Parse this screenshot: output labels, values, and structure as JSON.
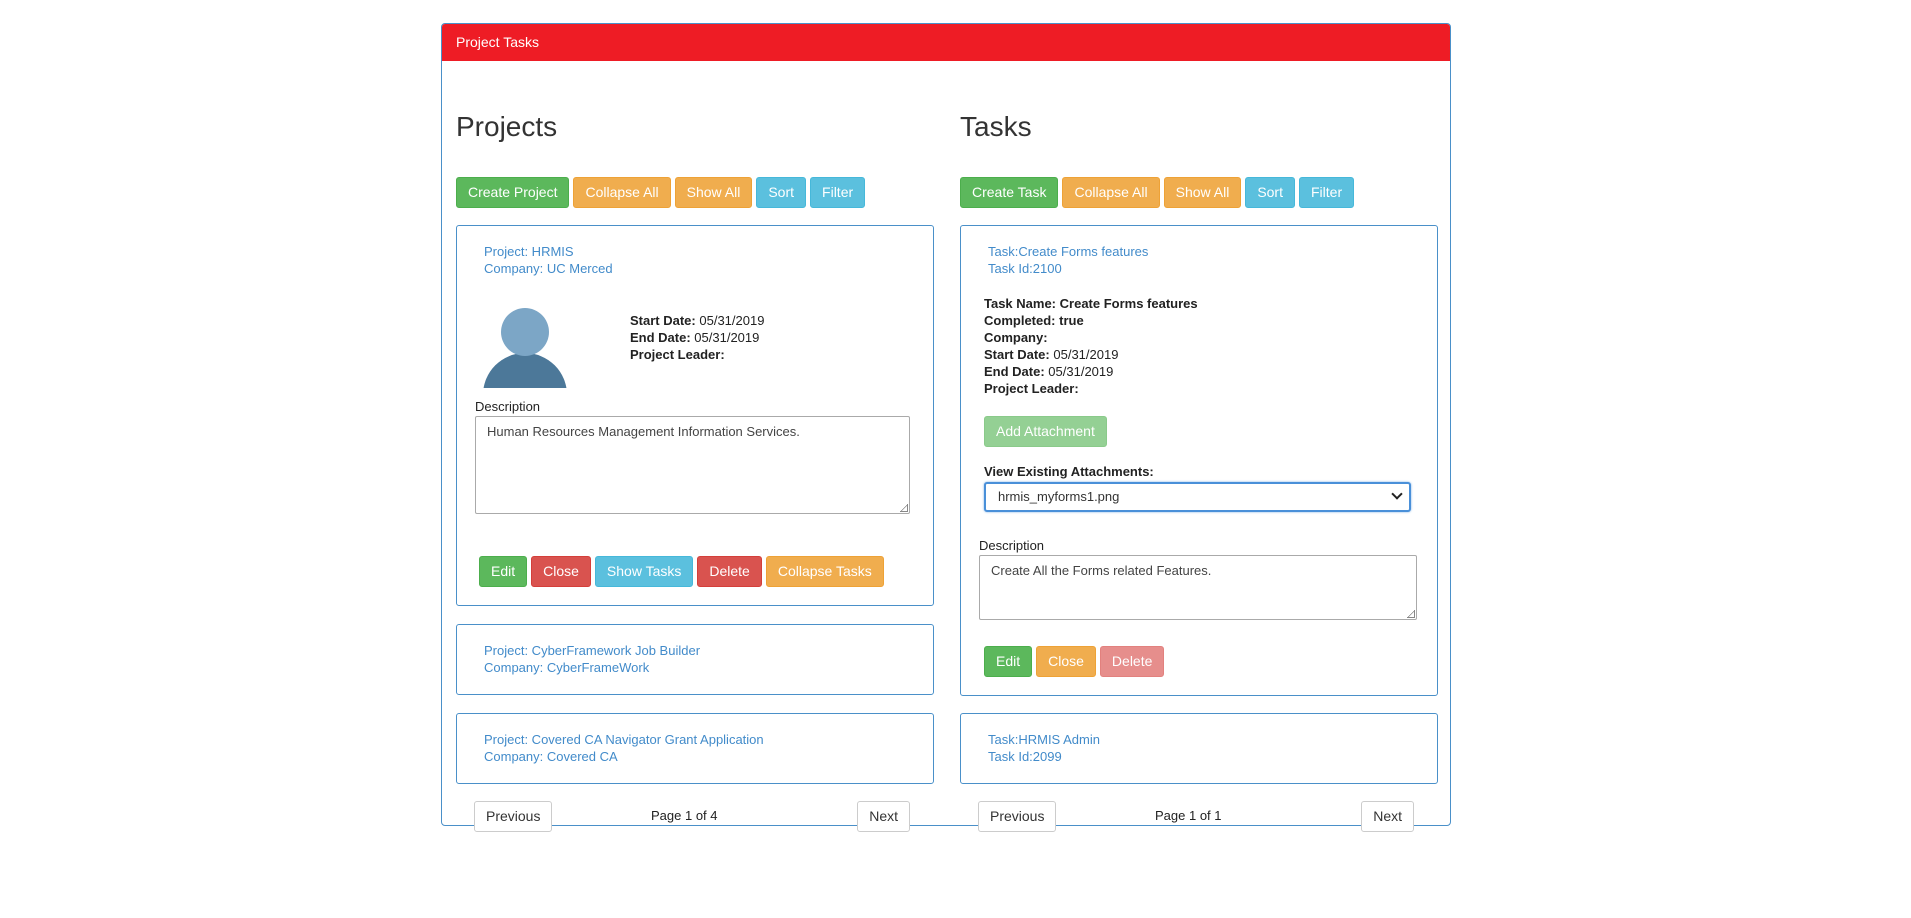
{
  "panel": {
    "title": "Project Tasks"
  },
  "projects": {
    "heading": "Projects",
    "toolbar": {
      "create": "Create Project",
      "collapse_all": "Collapse All",
      "show_all": "Show All",
      "sort": "Sort",
      "filter": "Filter"
    },
    "expanded": {
      "project_line": "Project: HRMIS",
      "company_line": "Company: UC Merced",
      "start_label": "Start Date:",
      "start_value": "05/31/2019",
      "end_label": "End Date:",
      "end_value": "05/31/2019",
      "leader_label": "Project Leader:",
      "leader_value": "",
      "description_label": "Description",
      "description": "Human Resources Management Information Services.",
      "actions": {
        "edit": "Edit",
        "close": "Close",
        "show_tasks": "Show Tasks",
        "delete": "Delete",
        "collapse_tasks": "Collapse Tasks"
      }
    },
    "collapsed": [
      {
        "project_line": "Project: CyberFramework Job Builder",
        "company_line": "Company: CyberFrameWork"
      },
      {
        "project_line": "Project: Covered CA Navigator Grant Application",
        "company_line": "Company: Covered CA"
      }
    ],
    "pager": {
      "previous": "Previous",
      "page": "Page 1 of 4",
      "next": "Next"
    }
  },
  "tasks": {
    "heading": "Tasks",
    "toolbar": {
      "create": "Create Task",
      "collapse_all": "Collapse All",
      "show_all": "Show All",
      "sort": "Sort",
      "filter": "Filter"
    },
    "expanded": {
      "task_line": "Task:Create Forms features",
      "id_line": "Task Id:2100",
      "name_label": "Task Name:",
      "name_value": "Create Forms features",
      "completed_label": "Completed:",
      "completed_value": "true",
      "company_label": "Company:",
      "company_value": "",
      "start_label": "Start Date:",
      "start_value": "05/31/2019",
      "end_label": "End Date:",
      "end_value": "05/31/2019",
      "leader_label": "Project Leader:",
      "leader_value": "",
      "add_attachment": "Add Attachment",
      "attachments_label": "View Existing Attachments:",
      "attachment_selected": "hrmis_myforms1.png",
      "description_label": "Description",
      "description": "Create All the Forms related Features.",
      "actions": {
        "edit": "Edit",
        "close": "Close",
        "delete": "Delete"
      }
    },
    "collapsed": [
      {
        "task_line": "Task:HRMIS Admin",
        "id_line": "Task Id:2099"
      }
    ],
    "pager": {
      "previous": "Previous",
      "page": "Page 1 of 1",
      "next": "Next"
    }
  },
  "colors": {
    "header_red": "#ee1c25",
    "border_blue": "#4a90c9",
    "link_blue": "#428bca",
    "success": "#5cb85c",
    "warning": "#f0ad4e",
    "info": "#5bc0de",
    "danger": "#d9534f"
  },
  "icons": {
    "avatar": "user-avatar-icon",
    "select_caret": "chevron-down-icon"
  }
}
